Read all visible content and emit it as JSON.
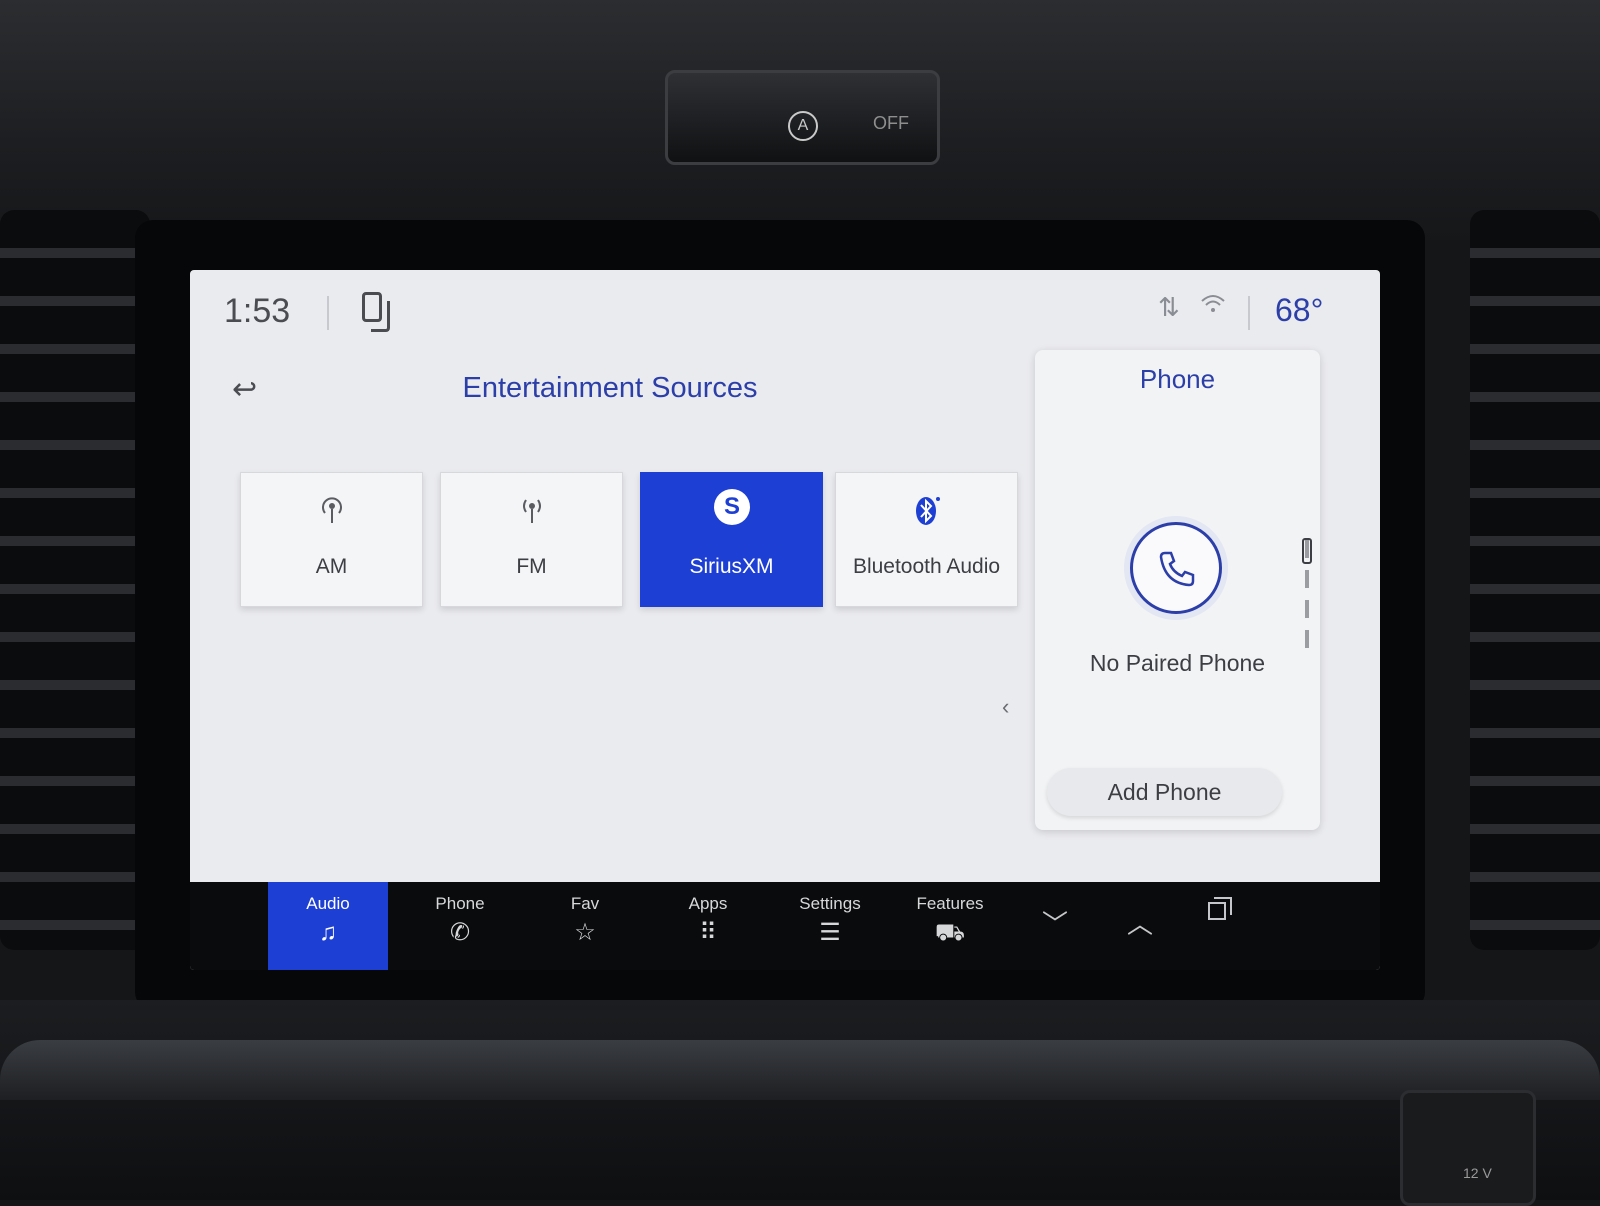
{
  "hazard": {
    "a_symbol": "A",
    "off_label": "OFF"
  },
  "status_bar": {
    "time": "1:53",
    "temperature": "68°",
    "icons": [
      "phone-projection-icon",
      "navigation-icon",
      "wifi-icon"
    ]
  },
  "main": {
    "back_icon": "↩",
    "title": "Entertainment Sources",
    "sources": [
      {
        "label": "AM",
        "icon": "am-antenna-icon"
      },
      {
        "label": "FM",
        "icon": "fm-antenna-icon"
      },
      {
        "label": "SiriusXM",
        "icon": "siriusxm-logo",
        "selected": true
      },
      {
        "label": "Bluetooth Audio",
        "icon": "bluetooth-icon"
      }
    ],
    "collapse_glyph": "‹"
  },
  "phone_panel": {
    "title": "Phone",
    "status": "No Paired Phone",
    "add_phone": "Add Phone"
  },
  "navbar": {
    "items": [
      {
        "label": "Audio",
        "icon": "♫",
        "active": true
      },
      {
        "label": "Phone",
        "icon": "✆"
      },
      {
        "label": "Fav",
        "icon": "☆"
      },
      {
        "label": "Apps",
        "icon": "⠿"
      },
      {
        "label": "Settings",
        "icon": "☰"
      },
      {
        "label": "Features",
        "icon": "⛟"
      }
    ]
  },
  "socket": {
    "label": "12 V"
  },
  "colors": {
    "accent": "#1e3fd4",
    "title_blue": "#2c3ea8",
    "screen_bg": "#eaebef",
    "navbar_bg": "#0a0b0c"
  }
}
